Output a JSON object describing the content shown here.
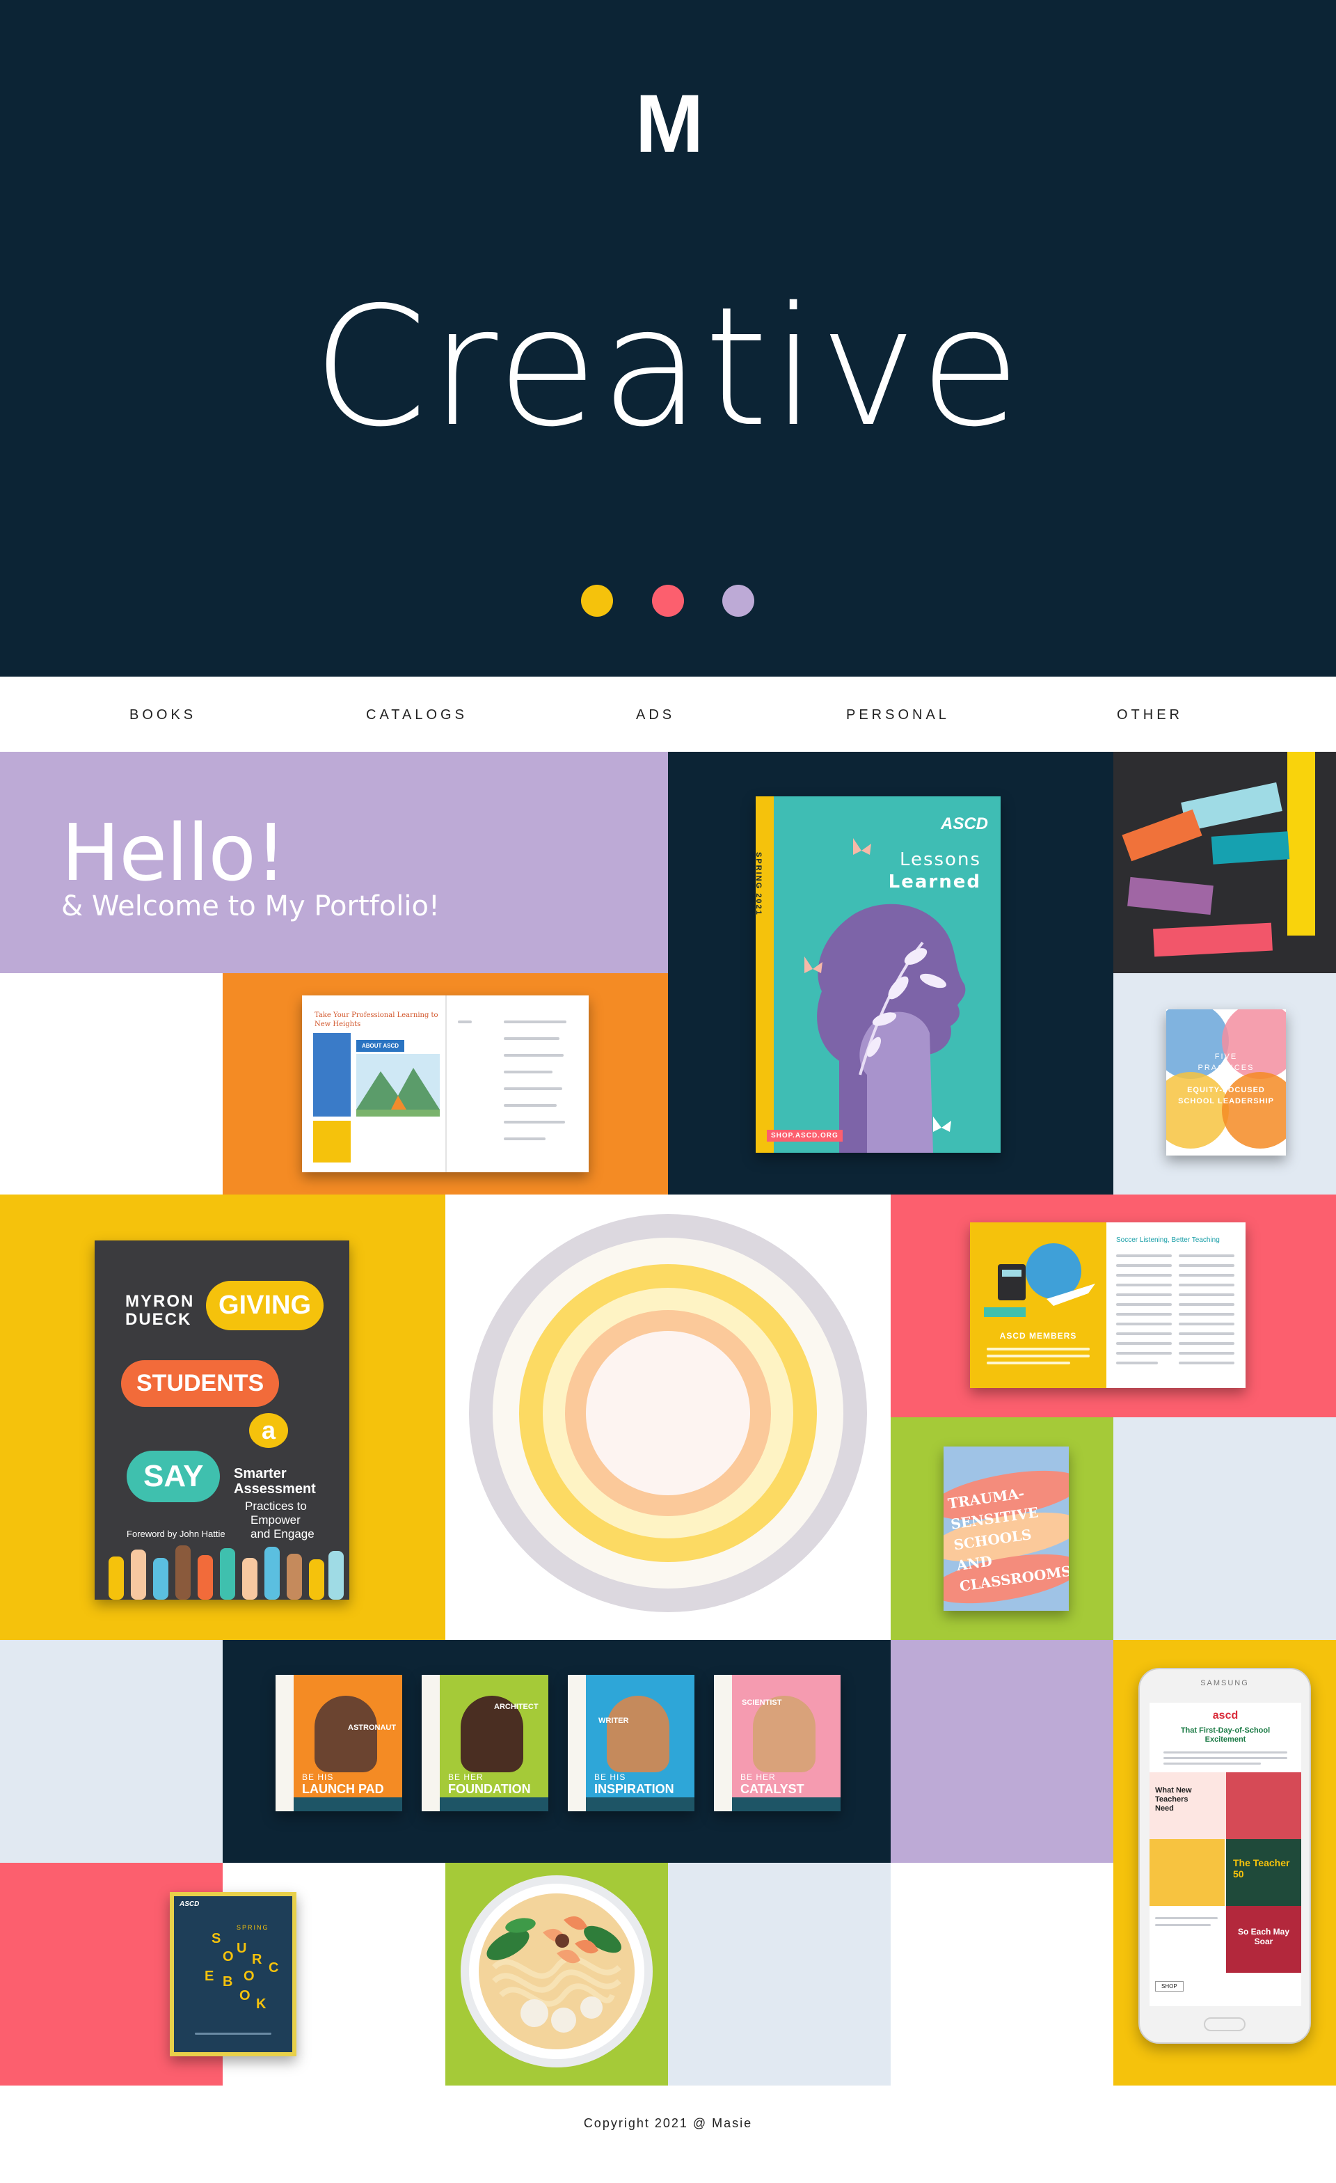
{
  "brand": {
    "logo_letter": "M"
  },
  "hero": {
    "title": "Creative",
    "dots": [
      "#f5c20c",
      "#fc5f6e",
      "#bdaad6"
    ]
  },
  "nav": {
    "items": [
      "BOOKS",
      "CATALOGS",
      "ADS",
      "PERSONAL",
      "OTHER"
    ]
  },
  "intro": {
    "title": "Hello!",
    "subtitle": "& Welcome to My Portfolio!"
  },
  "colors": {
    "navy": "#0c2435",
    "lavender": "#bdaad6",
    "orange": "#f48b24",
    "charcoal": "#2d2d30",
    "pale_blue": "#e1e9f2",
    "yellow": "#f5c20c",
    "coral": "#fc5f6e",
    "lime": "#a5ca38"
  },
  "items": {
    "lessons_learned": {
      "side": "SPRING 2021",
      "brand": "ASCD",
      "title_1": "Lessons",
      "title_2": "Learned",
      "url": "SHOP.ASCD.ORG"
    },
    "catalog_spread": {
      "heading": "Take Your Professional Learning to New Heights",
      "box": "ABOUT ASCD"
    },
    "five_practices": {
      "line1": "FIVE",
      "line2": "PRACTICES",
      "line3": "FOR",
      "line4": "EQUITY-FOCUSED",
      "line5": "SCHOOL LEADERSHIP"
    },
    "giving_students": {
      "author_1": "MYRON",
      "author_2": "DUECK",
      "w1": "GIVING",
      "w2": "STUDENTS",
      "w3": "a",
      "w4": "SAY",
      "sub_1": "Smarter",
      "sub_2": "Assessment",
      "sub_3": "Practices to",
      "sub_4": "Empower",
      "sub_5": "and Engage",
      "foreword": "Foreword by John Hattie"
    },
    "magazine_ad": {
      "label": "ASCD MEMBERS",
      "article_title": "Soccer Listening, Better Teaching"
    },
    "trauma": {
      "text": "TRAUMA-SENSITIVE SCHOOLS AND CLASSROOMS"
    },
    "ad_series": [
      {
        "tag": "BE HIS",
        "word": "LAUNCH PAD",
        "role": "ASTRONAUT"
      },
      {
        "tag": "BE HER",
        "word": "FOUNDATION",
        "role": "ARCHITECT"
      },
      {
        "tag": "BE HIS",
        "word": "INSPIRATION",
        "role": "WRITER"
      },
      {
        "tag": "BE HER",
        "word": "CATALYST",
        "role": "SCIENTIST"
      }
    ],
    "sourcebook": {
      "brand": "ASCD",
      "season": "SPRING",
      "letters": [
        "S",
        "O",
        "U",
        "R",
        "C",
        "E",
        "B",
        "O",
        "O",
        "K"
      ]
    },
    "phone_email": {
      "device": "SAMSUNG",
      "brand": "ascd",
      "headline": "That First-Day-of-School Excitement",
      "block1": "What New Teachers Need",
      "block2": "The Teacher 50",
      "block3": "So Each May Soar",
      "btn": "SHOP"
    }
  },
  "footer": {
    "text": "Copyright 2021 @ Masie"
  }
}
